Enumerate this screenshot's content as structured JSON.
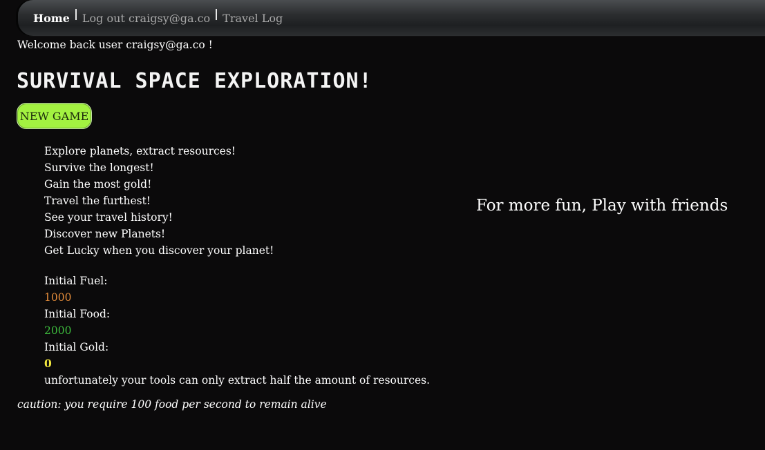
{
  "nav": {
    "items": [
      {
        "label": "Home",
        "active": true
      },
      {
        "label": "Log out craigsy@ga.co",
        "active": false
      },
      {
        "label": "Travel Log",
        "active": false
      }
    ]
  },
  "welcome": "Welcome back user craigsy@ga.co !",
  "title": "SURVIVAL SPACE EXPLORATION!",
  "new_game_label": "NEW GAME",
  "features": [
    "Explore planets, extract resources!",
    "Survive the longest!",
    "Gain the most gold!",
    "Travel the furthest!",
    "See your travel history!",
    "Discover new Planets!",
    "Get Lucky when you discover your planet!"
  ],
  "stats": {
    "fuel_label": "Initial Fuel:",
    "fuel_value": "1000",
    "food_label": "Initial Food:",
    "food_value": "2000",
    "gold_label": "Initial Gold:",
    "gold_value": "0",
    "note": "unfortunately your tools can only extract half the amount of resources."
  },
  "caution": "caution: you require 100 food per second to remain alive",
  "friends_text": "For more fun, Play with friends",
  "colors": {
    "button_bg": "#a3f241",
    "fuel": "#e28b3a",
    "food": "#3dbb3d",
    "gold": "#f3e83f"
  }
}
